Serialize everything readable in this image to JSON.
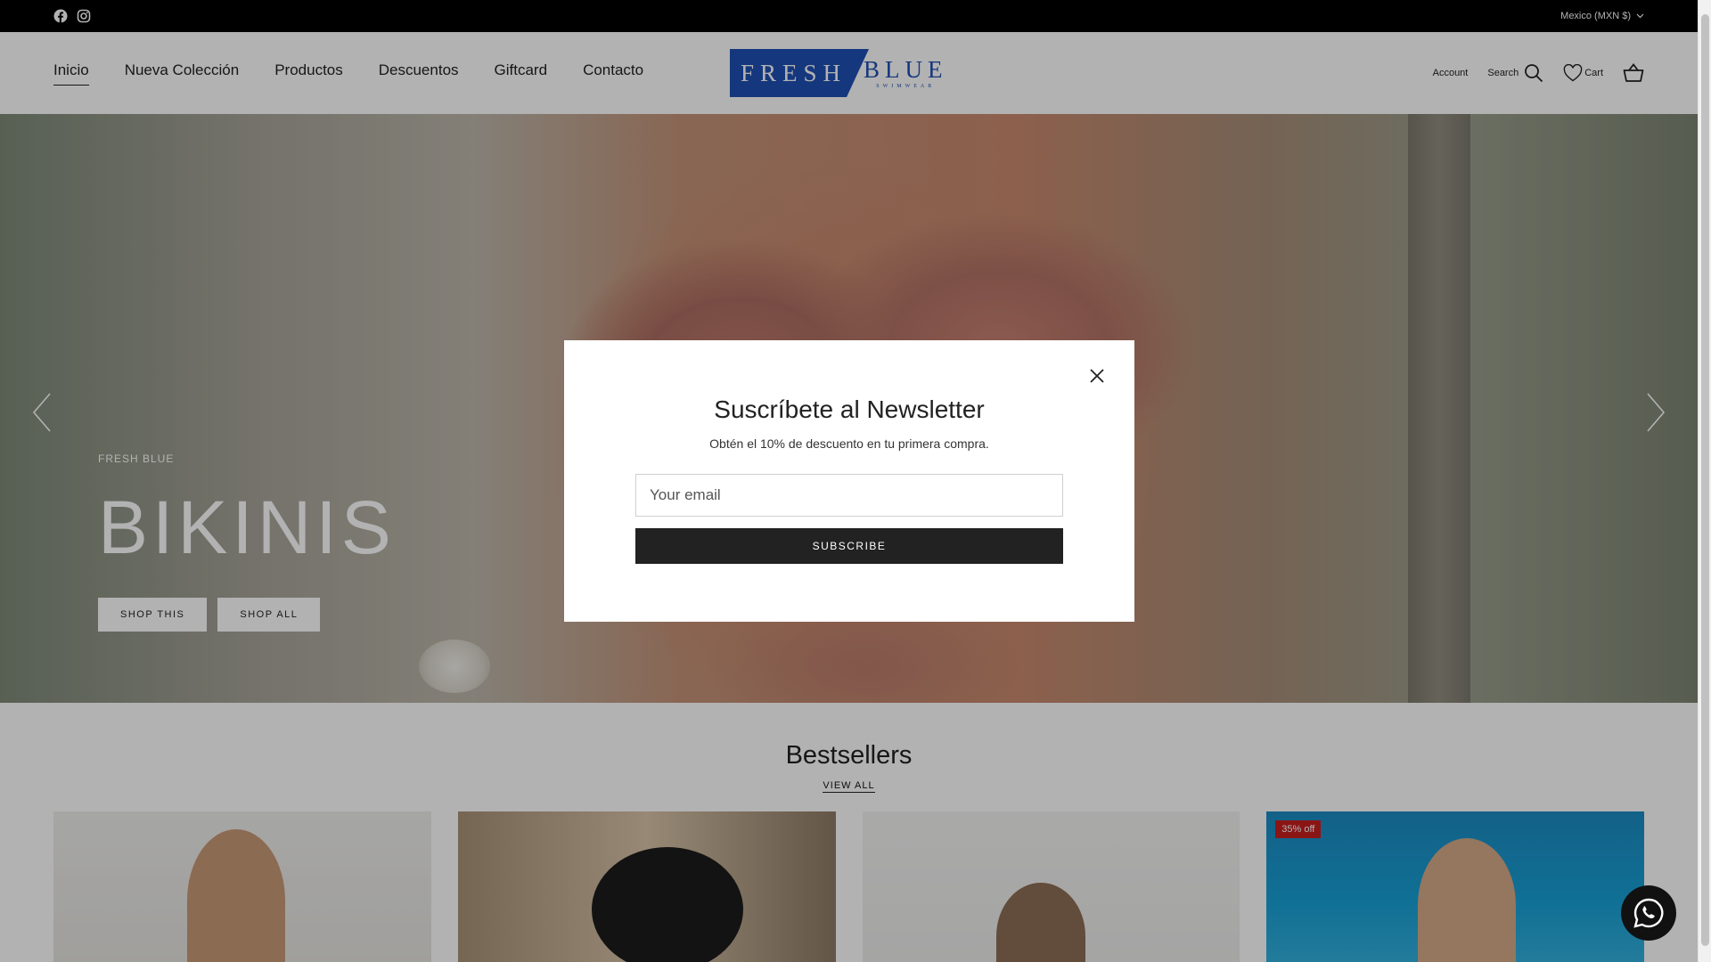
{
  "topbar": {
    "currency": "Mexico (MXN $)",
    "social": [
      "facebook-icon",
      "instagram-icon"
    ]
  },
  "header": {
    "nav": [
      {
        "label": "Inicio",
        "active": true
      },
      {
        "label": "Nueva Colección"
      },
      {
        "label": "Productos"
      },
      {
        "label": "Descuentos"
      },
      {
        "label": "Giftcard"
      },
      {
        "label": "Contacto"
      }
    ],
    "logo": {
      "word1": "FRESH",
      "word2": "BLUE",
      "tagline": "SWIMWEAR"
    },
    "account_label": "Account",
    "search_label": "Search",
    "cart_label": "Cart"
  },
  "hero": {
    "kicker": "FRESH BLUE",
    "title": "BIKINIS",
    "shop_this": "SHOP THIS",
    "shop_all": "SHOP ALL"
  },
  "bestsellers": {
    "title": "Bestsellers",
    "view_all": "VIEW ALL",
    "badge": "35% off"
  },
  "modal": {
    "title": "Suscríbete al Newsletter",
    "subtitle": "Obtén el 10% de descuento en tu primera compra.",
    "email_placeholder": "Your email",
    "subscribe": "SUBSCRIBE"
  },
  "colors": {
    "brand": "#1f4fb4",
    "badge": "#c61f1f",
    "button_dark": "#222222"
  }
}
